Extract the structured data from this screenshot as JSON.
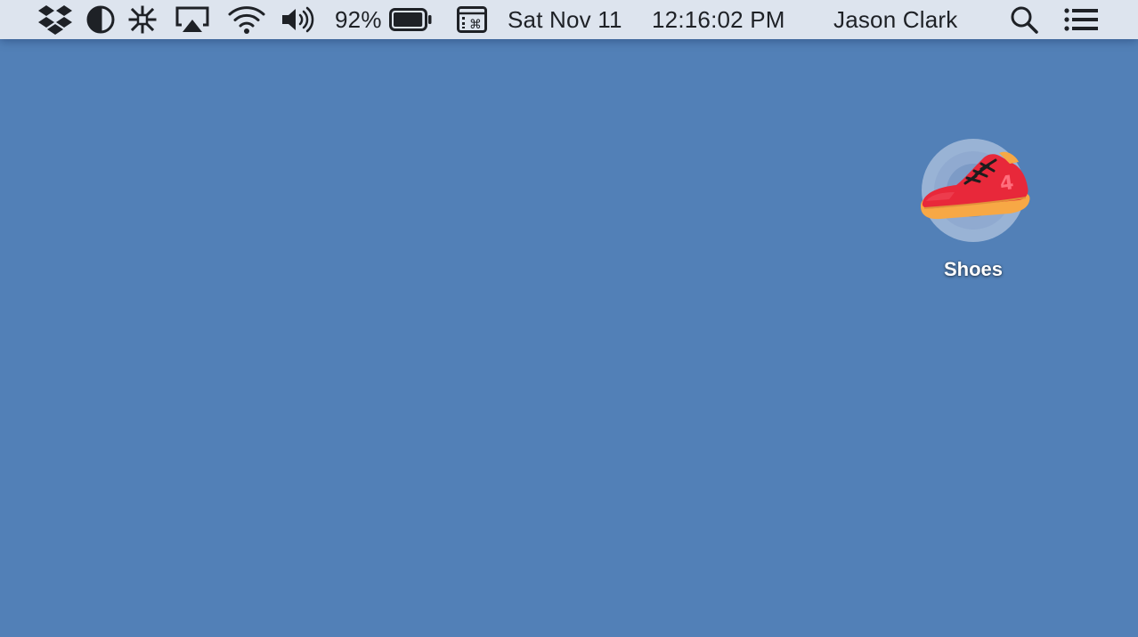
{
  "menubar": {
    "status_icons": [
      "dropbox-icon",
      "half-circle-icon",
      "snowflake-icon",
      "airplay-icon",
      "wifi-icon",
      "volume-icon"
    ],
    "battery_percent": "92%",
    "battery_level": 0.92,
    "date": "Sat Nov 11",
    "time": "12:16:02 PM",
    "user_name": "Jason Clark",
    "right_icons": [
      "spotlight-search-icon",
      "notification-center-icon"
    ]
  },
  "desktop": {
    "background_color": "#5280b7",
    "icons": [
      {
        "label": "Shoes",
        "icon": "sneaker-icon",
        "colors": {
          "shoe": "#e8283a",
          "sole": "#f7a845",
          "laces": "#1d1d1d",
          "halo": "#a6bcdb"
        }
      }
    ]
  }
}
